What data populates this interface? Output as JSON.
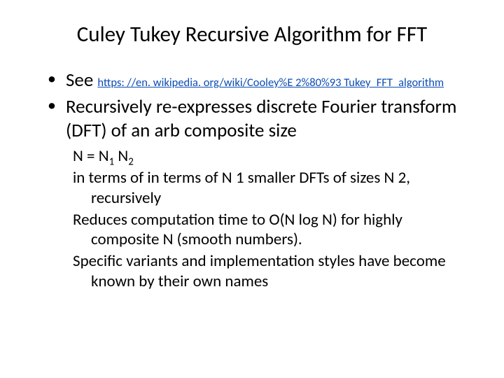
{
  "title": "Culey Tukey Recursive Algorithm for FFT",
  "bullets": {
    "see_prefix": "See ",
    "link_text": "https: //en. wikipedia. org/wiki/Cooley%E 2%80%93 Tukey_FFT_algorithm",
    "recursive": "Recursively re-expresses discrete Fourier transform (DFT) of an arb composite size"
  },
  "sub": {
    "eq_pre": "N = N",
    "eq_sub1": "1",
    "eq_mid": " N",
    "eq_sub2": "2",
    "line2": "in terms of in terms of N 1 smaller DFTs of sizes N 2, recursively",
    "line3": "Reduces  computation time to O(N log N) for highly composite N (smooth numbers).",
    "line4": "Specific variants and implementation styles have become known by their own names"
  }
}
